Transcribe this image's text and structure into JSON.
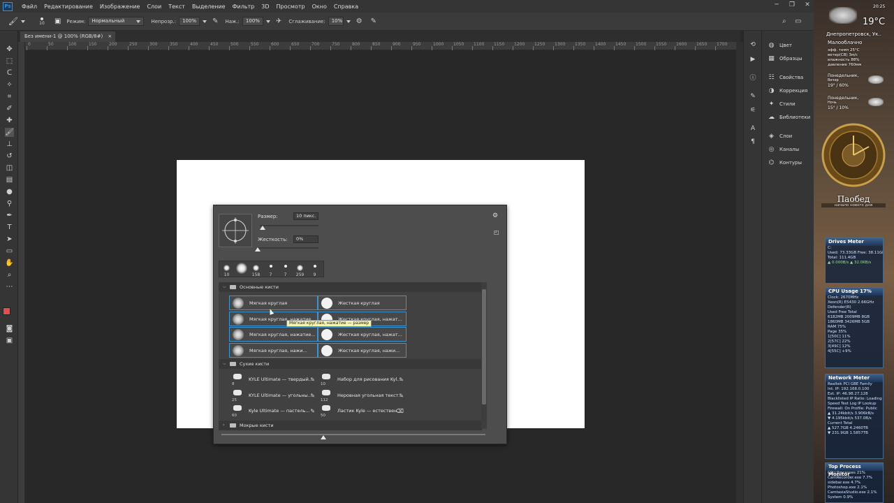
{
  "app": {
    "logo": "Ps"
  },
  "menu": [
    "Файл",
    "Редактирование",
    "Изображение",
    "Слои",
    "Текст",
    "Выделение",
    "Фильтр",
    "3D",
    "Просмотр",
    "Окно",
    "Справка"
  ],
  "options": {
    "brush_size": "10",
    "mode_label": "Режим:",
    "mode_value": "Нормальный",
    "opacity_label": "Непрозр.:",
    "opacity_value": "100%",
    "flow_label": "Наж.:",
    "flow_value": "100%",
    "smoothing_label": "Сглаживание:",
    "smoothing_value": "10%"
  },
  "doc_tab": {
    "title": "Без имени-1 @ 100% (RGB/8#)",
    "close": "×"
  },
  "ruler_numbers": [
    "0",
    "50",
    "100",
    "150",
    "200",
    "250",
    "300",
    "350",
    "400",
    "450",
    "500",
    "550",
    "600",
    "650",
    "700",
    "750",
    "800",
    "850",
    "900",
    "950",
    "1000",
    "1050",
    "1100",
    "1150",
    "1200",
    "1250",
    "1300",
    "1350",
    "1400",
    "1450",
    "1500",
    "1550",
    "1600",
    "1650",
    "1700"
  ],
  "brush_panel": {
    "size_label": "Размер:",
    "size_value": "10 пикс.",
    "hardness_label": "Жесткость:",
    "hardness_value": "0%",
    "size_slider": 0.05,
    "hardness_slider": 0.0,
    "presets": [
      {
        "n": "10",
        "soft": true
      },
      {
        "n": "",
        "soft": true
      },
      {
        "n": "158",
        "soft": true
      },
      {
        "n": "7",
        "soft": false
      },
      {
        "n": "7",
        "soft": false
      },
      {
        "n": "259",
        "soft": true
      },
      {
        "n": "9",
        "soft": false
      }
    ],
    "groups": {
      "basic": "Основные кисти",
      "dry": "Сухие кисти",
      "wet": "Мокрые кисти"
    },
    "basic_brushes": [
      "Мягкая круглая",
      "Жесткая круглая",
      "Мягкая круглая, нажатие...",
      "Жесткая круглая, нажат...",
      "Мягкая круглая, нажатие...",
      "Жесткая круглая, нажат...",
      "Мягкая круглая, нажи...",
      "Жесткая круглая, нажи..."
    ],
    "dry_brushes": [
      {
        "name": "KYLE  Ultimate — твердый...",
        "num": "8"
      },
      {
        "name": "Набор для рисования Kyl...",
        "num": "10"
      },
      {
        "name": "KYLE  Ultimate — угольны...",
        "num": "25"
      },
      {
        "name": "Неровная угольная текст...",
        "num": "112"
      },
      {
        "name": "Kyle  Ultimate — пастель...",
        "num": "60"
      },
      {
        "name": "Ластик Kyle — естествен...",
        "num": "50"
      }
    ],
    "tooltip": "Мягкая круглая, нажатие — размер"
  },
  "right_panel": {
    "items": [
      "Цвет",
      "Образцы",
      "Свойства",
      "Коррекция",
      "Стили",
      "Библиотеки",
      "Слои",
      "Каналы",
      "Контуры"
    ]
  },
  "widgets": {
    "time": "20:25",
    "temperature": "19°C",
    "city": "Днепропетровск, Ук..",
    "condition": "Малооблачно",
    "details": [
      "эфф. темп     25°C",
      "ветер(СВ)      3м/с",
      "влажность      88%",
      "давление     760мм"
    ],
    "forecast": [
      {
        "day": "Понедельник,",
        "part": "Вечер",
        "val": "19° / 60%"
      },
      {
        "day": "Понедельник,",
        "part": "Ночь",
        "val": "15° / 10%"
      }
    ],
    "clock_caption": "Паобед",
    "clock_sub": "начало нового дня",
    "drives": {
      "title": "Drives Meter",
      "rows": [
        "C:",
        "Used: 73.33GB    Free: 38.11GB",
        "Total: 111.4GB",
        "▲ 0.000B/s        ▲ 32.0KB/s"
      ]
    },
    "cpu": {
      "title": "CPU Usage",
      "pct": "17%",
      "rows": [
        "Clock: 2670MHz",
        "Xeon(R) E5430 2.66GHz",
        "Defender(R)",
        "Used   Free   Total",
        "6182MB  2009MB  8GB",
        "1860MB  3426MB  5GB",
        "RAM      75%",
        "Page     35%",
        "1[50C]   11%",
        "2[57C]   22%",
        "3[49C]   12%",
        "4[55C]   +9%"
      ]
    },
    "network": {
      "title": "Network Meter",
      "rows": [
        "Realtek PCI GBE Family",
        "Int. IP: 192.168.0.100",
        "Ext. IP: 46.98.27.128",
        "Blacklisted IP Ratio: Loading",
        "Speed Test   Log   IP Lookup",
        "Firewall: On    Profile: Public",
        "▲ 31.24kbit/s   3.906kB/s",
        "▼ 4.195kbit/s   537.0B/s",
        "Current        Total",
        "▲ 527.7GB    4.2460TB",
        "▼ 231.9GB    1.5857TB"
      ]
    },
    "process": {
      "title": "Top Process Monitor",
      "rows": [
        "CPU Processes 21%",
        "CamRecorder.exe   7.7%",
        "sidebar.exe       4.7%",
        "Photoshop.exe     2.1%",
        "CamtasiaStudio.exe 2.1%",
        "System            0.9%"
      ]
    }
  },
  "colors": {
    "accent": "#3d95d1",
    "foreground_swatch": "#e34f4f",
    "background_swatch": "#ffffff"
  }
}
